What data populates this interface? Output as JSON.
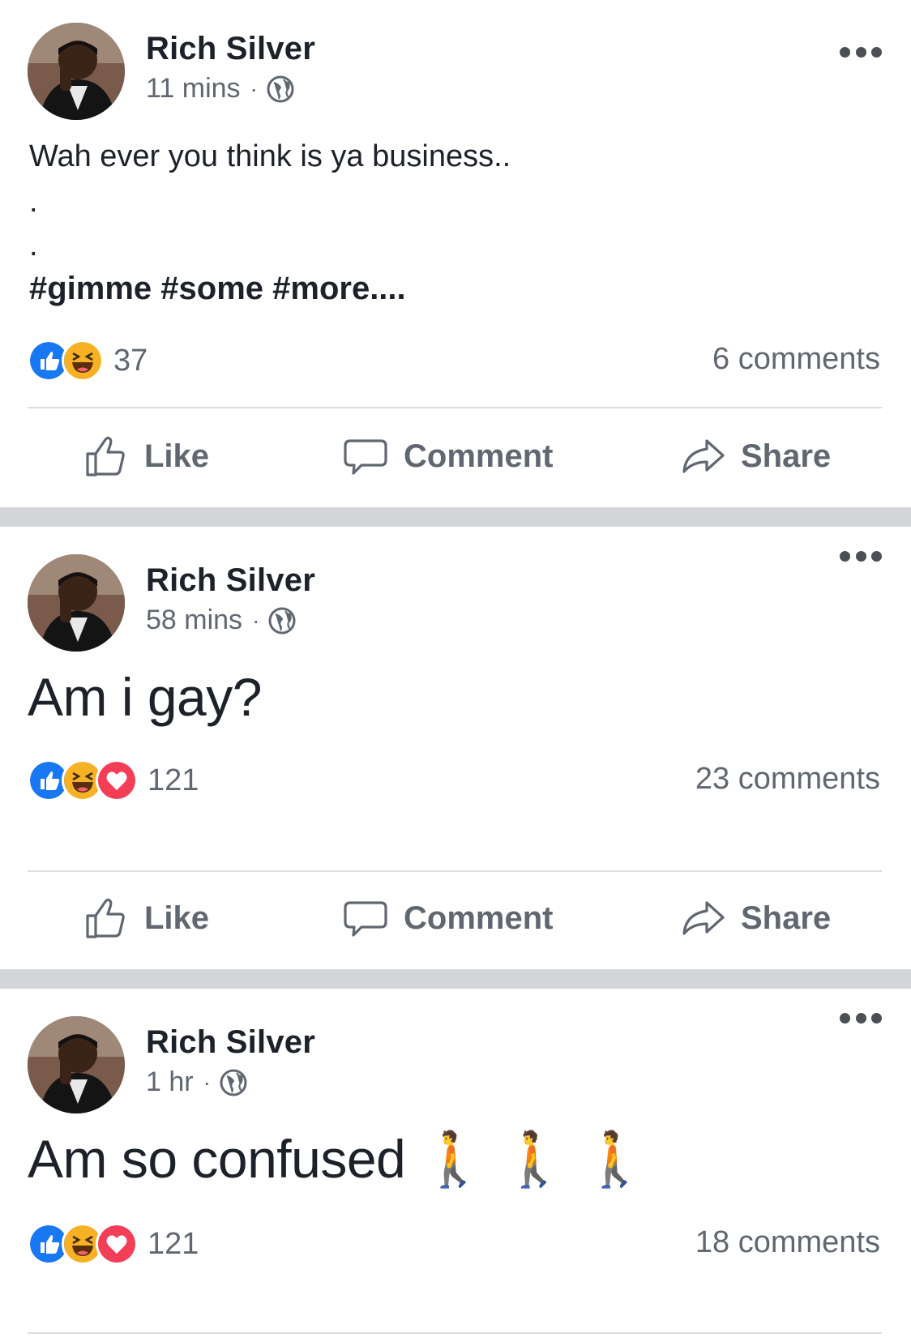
{
  "posts": [
    {
      "author": "Rich Silver",
      "time": "11 mins",
      "body_lines": [
        "Wah ever you think is ya business..",
        ".",
        "."
      ],
      "tags": "#gimme  #some #more....",
      "reaction_count": "37",
      "reactions": [
        "like",
        "haha"
      ],
      "comments": "6 comments"
    },
    {
      "author": "Rich Silver",
      "time": "58 mins",
      "body": "Am i gay?",
      "reaction_count": "121",
      "reactions": [
        "like",
        "haha",
        "love"
      ],
      "comments": "23 comments"
    },
    {
      "author": "Rich Silver",
      "time": "1 hr",
      "body": "Am so confused 🚶 🚶 🚶",
      "reaction_count": "121",
      "reactions": [
        "like",
        "haha",
        "love"
      ],
      "comments": "18 comments"
    }
  ],
  "actions": {
    "like": "Like",
    "comment": "Comment",
    "share": "Share"
  },
  "colors": {
    "like_blue": "#1877f2",
    "haha_yellow": "#f7b125",
    "love_red": "#f33e58",
    "separator": "#d4d5d9",
    "secondary_text": "#606770"
  }
}
